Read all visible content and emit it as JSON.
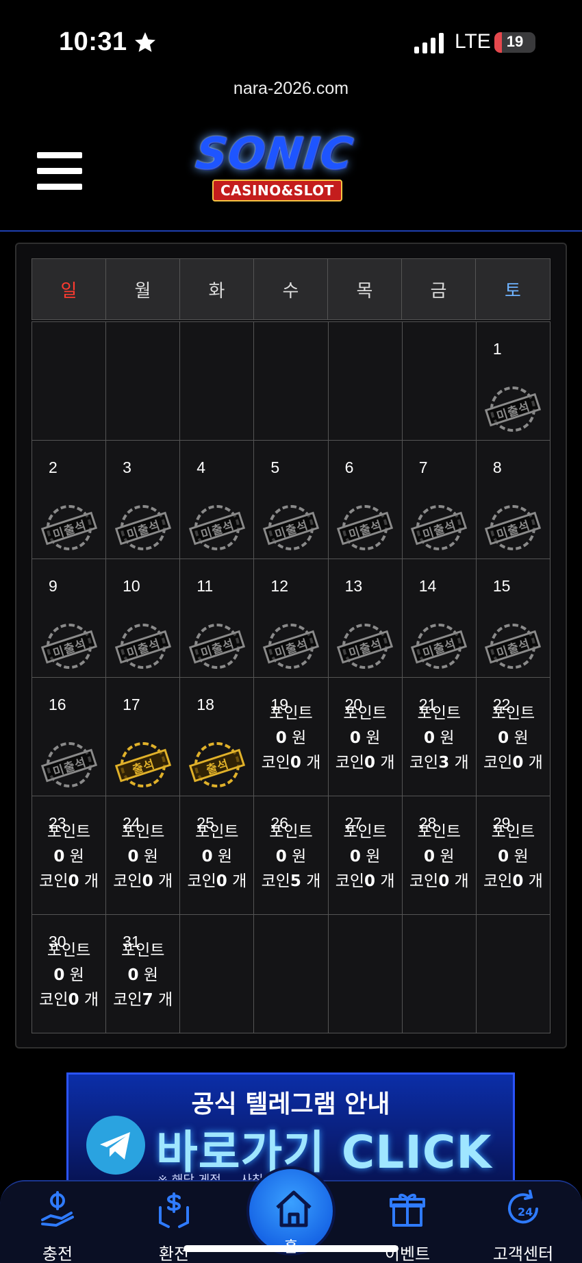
{
  "status_bar": {
    "time": "10:31",
    "network": "LTE",
    "battery": "19",
    "battery_level": 0.19
  },
  "browser": {
    "url": "nara-2026.com"
  },
  "logo": {
    "main": "SONIC",
    "sub": "CASINO&SLOT"
  },
  "weekdays": [
    "일",
    "월",
    "화",
    "수",
    "목",
    "금",
    "토"
  ],
  "stamp_text": {
    "absent": "미출석",
    "present": "출석"
  },
  "reward_labels": {
    "point": "포인트",
    "won": "원",
    "coin": "코인",
    "unit": "개"
  },
  "days": [
    {
      "day": "1",
      "status": "absent"
    },
    {
      "day": "2",
      "status": "absent"
    },
    {
      "day": "3",
      "status": "absent"
    },
    {
      "day": "4",
      "status": "absent"
    },
    {
      "day": "5",
      "status": "absent"
    },
    {
      "day": "6",
      "status": "absent"
    },
    {
      "day": "7",
      "status": "absent"
    },
    {
      "day": "8",
      "status": "absent"
    },
    {
      "day": "9",
      "status": "absent"
    },
    {
      "day": "10",
      "status": "absent"
    },
    {
      "day": "11",
      "status": "absent"
    },
    {
      "day": "12",
      "status": "absent"
    },
    {
      "day": "13",
      "status": "absent"
    },
    {
      "day": "14",
      "status": "absent"
    },
    {
      "day": "15",
      "status": "absent"
    },
    {
      "day": "16",
      "status": "absent"
    },
    {
      "day": "17",
      "status": "present"
    },
    {
      "day": "18",
      "status": "present"
    },
    {
      "day": "19",
      "status": "reward",
      "point": "0",
      "coin": "0"
    },
    {
      "day": "20",
      "status": "reward",
      "point": "0",
      "coin": "0"
    },
    {
      "day": "21",
      "status": "reward",
      "point": "0",
      "coin": "3"
    },
    {
      "day": "22",
      "status": "reward",
      "point": "0",
      "coin": "0"
    },
    {
      "day": "23",
      "status": "reward",
      "point": "0",
      "coin": "0"
    },
    {
      "day": "24",
      "status": "reward",
      "point": "0",
      "coin": "0"
    },
    {
      "day": "25",
      "status": "reward",
      "point": "0",
      "coin": "0"
    },
    {
      "day": "26",
      "status": "reward",
      "point": "0",
      "coin": "5"
    },
    {
      "day": "27",
      "status": "reward",
      "point": "0",
      "coin": "0"
    },
    {
      "day": "28",
      "status": "reward",
      "point": "0",
      "coin": "0"
    },
    {
      "day": "29",
      "status": "reward",
      "point": "0",
      "coin": "0"
    },
    {
      "day": "30",
      "status": "reward",
      "point": "0",
      "coin": "0"
    },
    {
      "day": "31",
      "status": "reward",
      "point": "0",
      "coin": "7"
    }
  ],
  "leading_blank_days": 6,
  "banner": {
    "title": "공식 텔레그램 안내",
    "cta": "바로가기 CLICK",
    "note": "※ 해당 게정 ... 사칭입니다"
  },
  "bottom_nav": {
    "deposit": "충전",
    "withdraw": "환전",
    "home": "홈",
    "event": "이벤트",
    "support": "고객센터"
  },
  "colors": {
    "accent": "#1766e6",
    "sunday": "#ff3b30",
    "saturday": "#6fb3ff",
    "present_stamp": "#e0b12a",
    "absent_stamp": "#8a8a8a"
  }
}
